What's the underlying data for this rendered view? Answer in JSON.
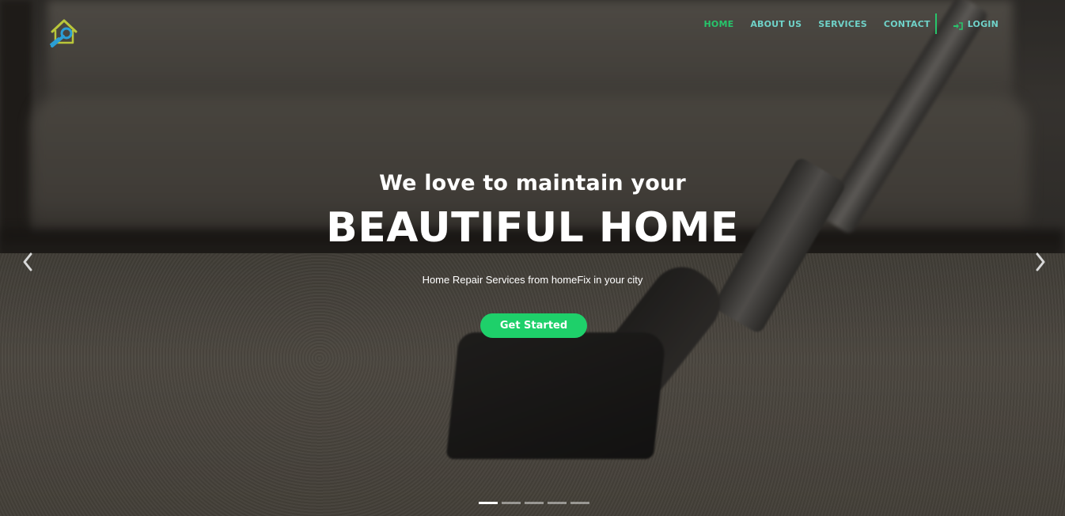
{
  "brand": {
    "logo_icon": "house-wrench-icon",
    "accent_color": "#27c56b",
    "nav_link_color": "#6fd2c8"
  },
  "nav": {
    "items": [
      {
        "label": "HOME",
        "active": true
      },
      {
        "label": "ABOUT US",
        "active": false
      },
      {
        "label": "SERVICES",
        "active": false
      },
      {
        "label": "CONTACT",
        "active": false
      }
    ],
    "login": {
      "label": "LOGIN",
      "icon": "sign-in-icon"
    }
  },
  "hero": {
    "subhead": "We love to maintain your",
    "headline": "BEAUTIFUL HOME",
    "tagline": "Home Repair Services from homeFix in your city",
    "cta_label": "Get Started",
    "cta_color": "#1ed06a"
  },
  "carousel": {
    "prev_icon": "chevron-left-icon",
    "next_icon": "chevron-right-icon",
    "slide_count": 5,
    "active_slide": 1
  }
}
